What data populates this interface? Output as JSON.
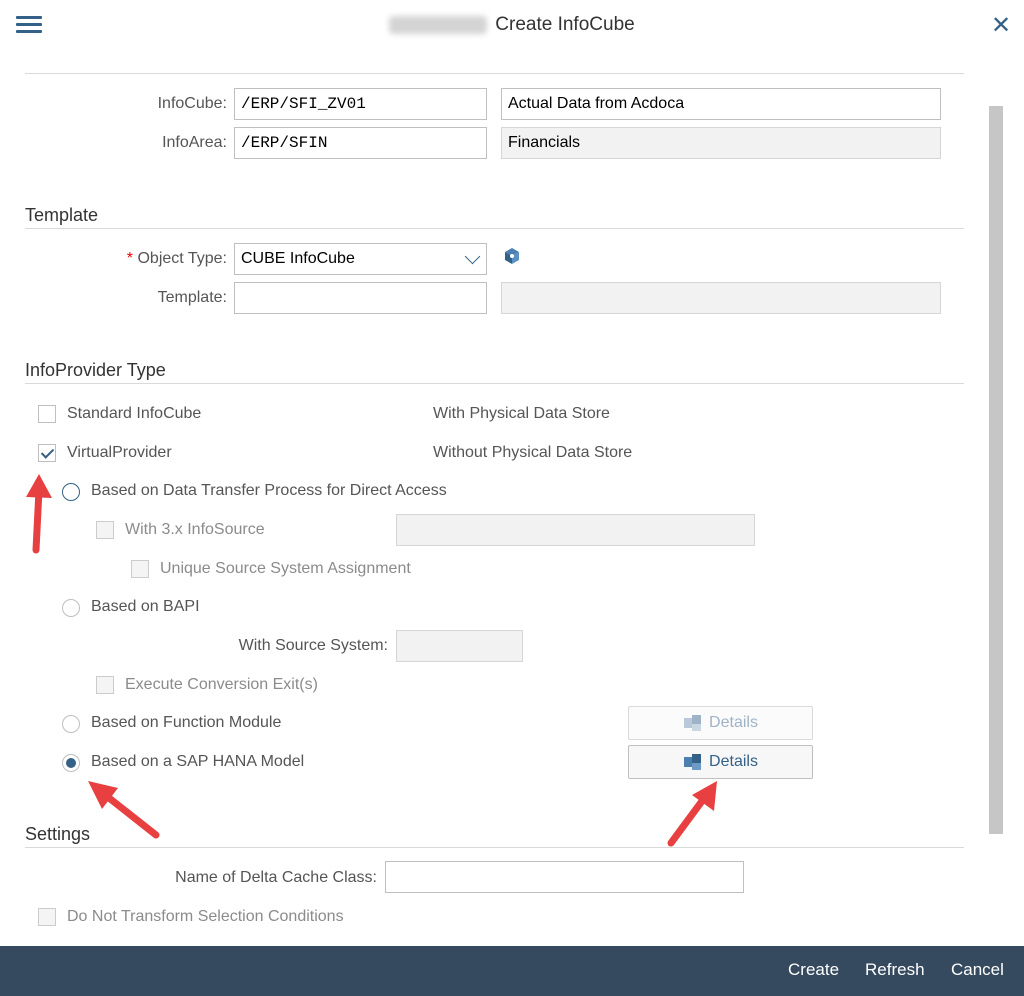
{
  "window": {
    "title_obscured": "[blurred]",
    "title": "Create InfoCube"
  },
  "header_fields": {
    "infocube_label": "InfoCube:",
    "infocube_value": "/ERP/SFI_ZV01",
    "infocube_desc": "Actual Data from Acdoca",
    "infoarea_label": "InfoArea:",
    "infoarea_value": "/ERP/SFIN",
    "infoarea_desc": "Financials"
  },
  "template": {
    "section_title": "Template",
    "required_mark": "*",
    "object_type_label": "Object Type:",
    "object_type_value": "CUBE InfoCube",
    "template_label": "Template:",
    "template_value": "",
    "template_desc": ""
  },
  "infoprovider": {
    "section_title": "InfoProvider Type",
    "standard_label": "Standard InfoCube",
    "standard_desc": "With Physical Data Store",
    "virtual_label": "VirtualProvider",
    "virtual_desc": "Without Physical Data Store",
    "opt_dtp": "Based on Data Transfer Process for Direct Access",
    "opt_3x_infosource": "With 3.x InfoSource",
    "opt_unique_source": "Unique Source System Assignment",
    "opt_bapi": "Based on BAPI",
    "source_system_label": "With Source System:",
    "opt_conversion_exit": "Execute Conversion Exit(s)",
    "opt_function_module": "Based on Function Module",
    "opt_hana_model": "Based on a SAP HANA Model",
    "details_label": "Details",
    "selected_option": "Based on a SAP HANA Model",
    "virtual_checked": true
  },
  "settings": {
    "section_title": "Settings",
    "delta_cache_label": "Name of Delta Cache Class:",
    "delta_cache_value": "",
    "no_transform_label": "Do Not Transform Selection Conditions"
  },
  "footer": {
    "create": "Create",
    "refresh": "Refresh",
    "cancel": "Cancel"
  },
  "colors": {
    "accent": "#346187",
    "footer_bg": "#354a5f",
    "annotation_arrow": "#e84040"
  },
  "icons": [
    "menu-icon",
    "close-icon",
    "cube-icon",
    "details-icon",
    "checkmark-icon",
    "annotation-arrow"
  ]
}
